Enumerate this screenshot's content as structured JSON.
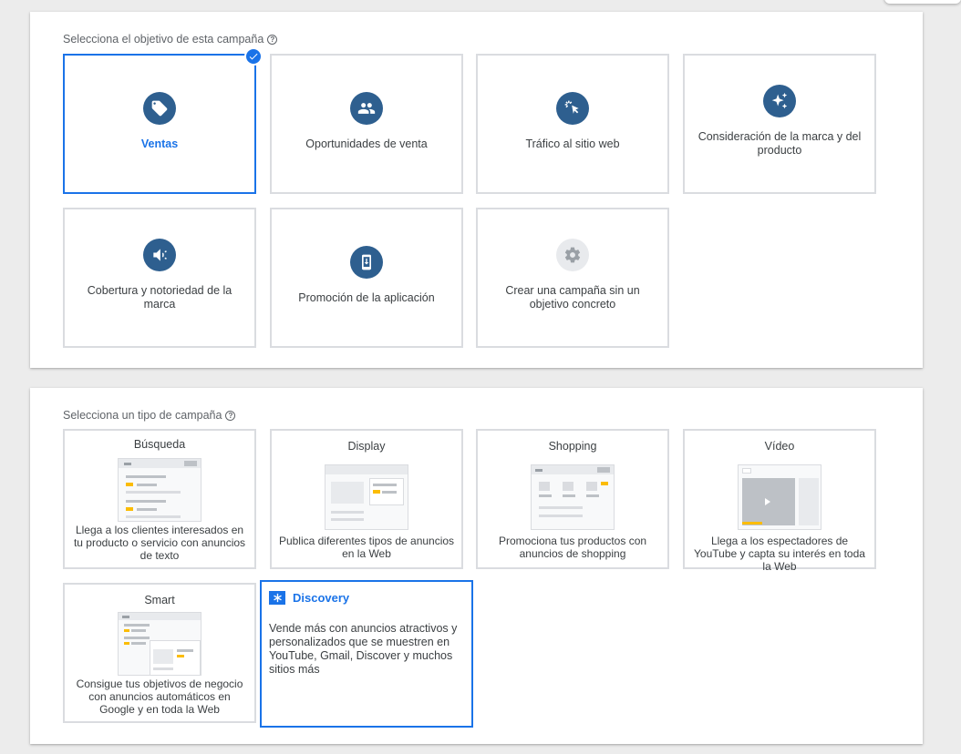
{
  "objective_section": {
    "label": "Selecciona el objetivo de esta campaña",
    "help_icon": "help-circle-icon",
    "cards": [
      {
        "id": "ventas",
        "label": "Ventas",
        "icon": "tag-icon",
        "selected": true
      },
      {
        "id": "oportunidades",
        "label": "Oportunidades de venta",
        "icon": "people-icon",
        "selected": false
      },
      {
        "id": "trafico",
        "label": "Tráfico al sitio web",
        "icon": "cursor-click-icon",
        "selected": false
      },
      {
        "id": "consideracion",
        "label": "Consideración de la marca y del producto",
        "icon": "sparkle-icon",
        "selected": false
      },
      {
        "id": "cobertura",
        "label": "Cobertura y notoriedad de la marca",
        "icon": "speaker-icon",
        "selected": false
      },
      {
        "id": "app",
        "label": "Promoción de la aplicación",
        "icon": "phone-download-icon",
        "selected": false
      },
      {
        "id": "sin_objetivo",
        "label": "Crear una campaña sin un objetivo concreto",
        "icon": "gear-icon",
        "selected": false
      }
    ]
  },
  "campaign_section": {
    "label": "Selecciona un tipo de campaña",
    "help_icon": "help-circle-icon",
    "cards": [
      {
        "id": "busqueda",
        "title": "Búsqueda",
        "desc": "Llega a los clientes interesados en tu producto o servicio con anuncios de texto"
      },
      {
        "id": "display",
        "title": "Display",
        "desc": "Publica diferentes tipos de anuncios en la Web"
      },
      {
        "id": "shopping",
        "title": "Shopping",
        "desc": "Promociona tus productos con anuncios de shopping"
      },
      {
        "id": "video",
        "title": "Vídeo",
        "desc": "Llega a los espectadores de YouTube y capta su interés en toda la Web"
      },
      {
        "id": "smart",
        "title": "Smart",
        "desc": "Consigue tus objetivos de negocio con anuncios automáticos en Google y en toda la Web"
      }
    ],
    "discovery": {
      "title": "Discovery",
      "desc": "Vende más con anuncios atractivos y personalizados que se muestren en YouTube, Gmail, Discover y muchos sitios más",
      "icon": "discovery-asterisk-icon",
      "selected": true
    }
  },
  "colors": {
    "accent": "#1a73e8",
    "icon_circle": "#2e5f8f",
    "highlight_yellow": "#fbbc04"
  }
}
